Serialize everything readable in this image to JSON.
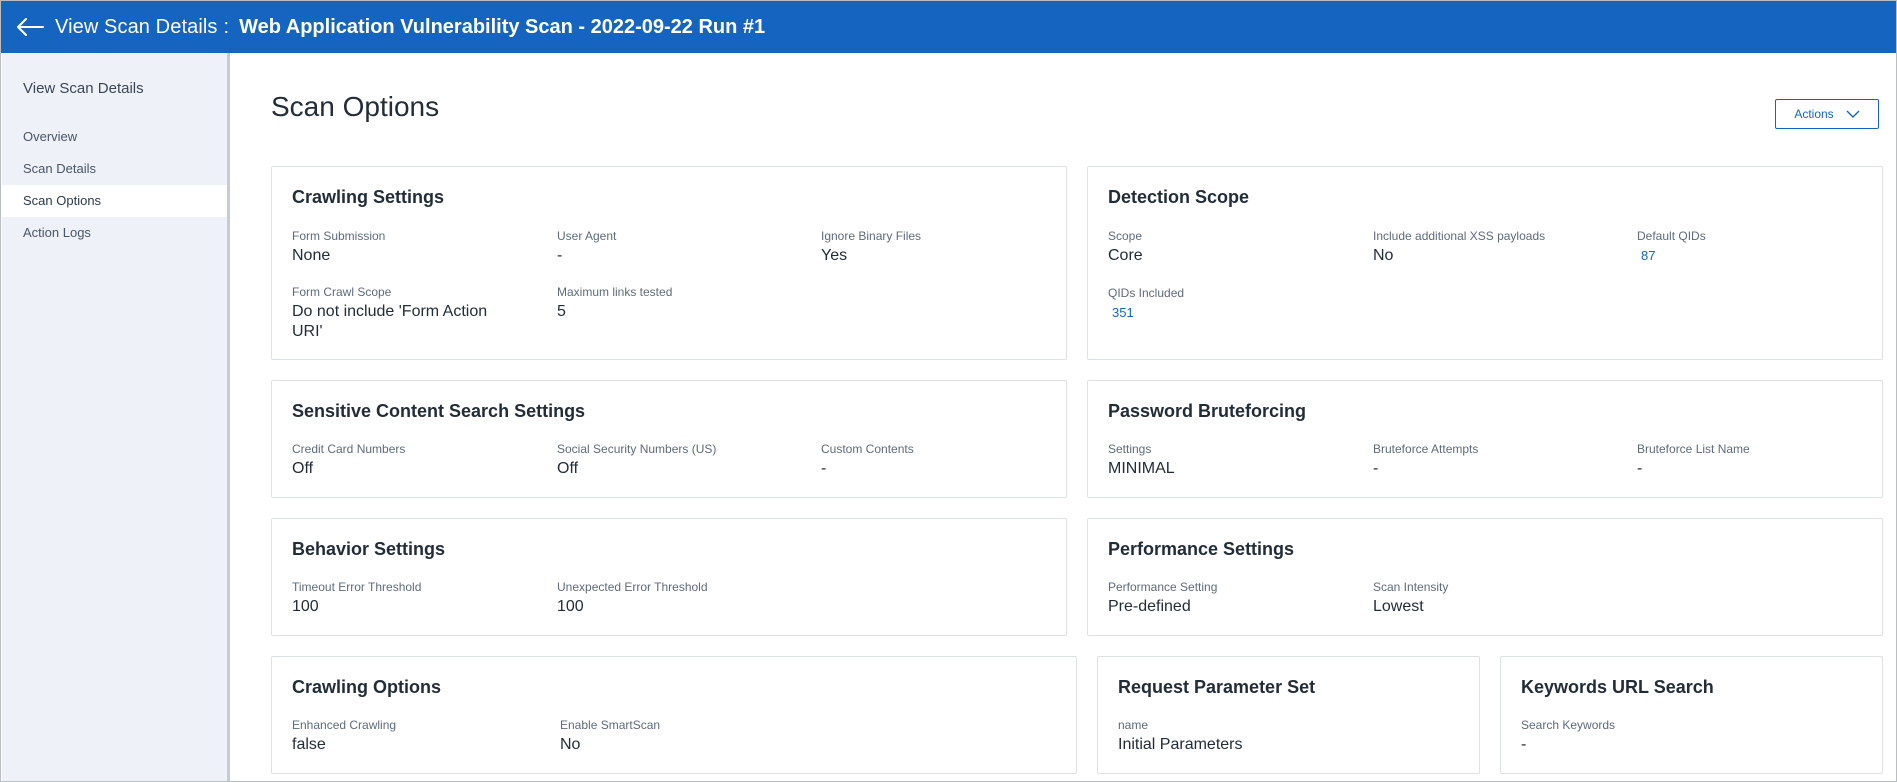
{
  "header": {
    "title_prefix": "View Scan Details",
    "separator": ":",
    "scan_name": "Web Application Vulnerability Scan - 2022-09-22 Run #1"
  },
  "sidebar": {
    "title": "View Scan Details",
    "items": [
      {
        "label": "Overview"
      },
      {
        "label": "Scan Details"
      },
      {
        "label": "Scan Options"
      },
      {
        "label": "Action Logs"
      }
    ]
  },
  "page": {
    "title": "Scan Options",
    "actions_label": "Actions"
  },
  "cards": {
    "crawling_settings": {
      "title": "Crawling Settings",
      "fields": [
        {
          "label": "Form Submission",
          "value": "None"
        },
        {
          "label": "User Agent",
          "value": "-"
        },
        {
          "label": "Ignore Binary Files",
          "value": "Yes"
        },
        {
          "label": "Form Crawl Scope",
          "value": "Do not include 'Form Action URI'"
        },
        {
          "label": "Maximum links tested",
          "value": "5"
        }
      ]
    },
    "detection_scope": {
      "title": "Detection Scope",
      "fields": [
        {
          "label": "Scope",
          "value": "Core"
        },
        {
          "label": "Include additional XSS payloads",
          "value": "No"
        },
        {
          "label": "Default QIDs",
          "value": "87"
        },
        {
          "label": "QIDs Included",
          "value": "351"
        }
      ]
    },
    "sensitive_content": {
      "title": "Sensitive Content Search Settings",
      "fields": [
        {
          "label": "Credit Card Numbers",
          "value": "Off"
        },
        {
          "label": "Social Security Numbers (US)",
          "value": "Off"
        },
        {
          "label": "Custom Contents",
          "value": "-"
        }
      ]
    },
    "password_bruteforcing": {
      "title": "Password Bruteforcing",
      "fields": [
        {
          "label": "Settings",
          "value": "MINIMAL"
        },
        {
          "label": "Bruteforce Attempts",
          "value": "-"
        },
        {
          "label": "Bruteforce List Name",
          "value": "-"
        }
      ]
    },
    "behavior_settings": {
      "title": "Behavior Settings",
      "fields": [
        {
          "label": "Timeout Error Threshold",
          "value": "100"
        },
        {
          "label": "Unexpected Error Threshold",
          "value": "100"
        }
      ]
    },
    "performance_settings": {
      "title": "Performance Settings",
      "fields": [
        {
          "label": "Performance Setting",
          "value": "Pre-defined"
        },
        {
          "label": "Scan Intensity",
          "value": "Lowest"
        }
      ]
    },
    "crawling_options": {
      "title": "Crawling Options",
      "fields": [
        {
          "label": "Enhanced Crawling",
          "value": "false"
        },
        {
          "label": "Enable SmartScan",
          "value": "No"
        }
      ]
    },
    "request_parameter_set": {
      "title": "Request Parameter Set",
      "fields": [
        {
          "label": "name",
          "value": "Initial Parameters"
        }
      ]
    },
    "keywords_url_search": {
      "title": "Keywords URL Search",
      "fields": [
        {
          "label": "Search Keywords",
          "value": "-"
        }
      ]
    }
  },
  "colors": {
    "header_bg": "#1565c0",
    "sidebar_bg": "#eef2f8",
    "link": "#1565c0"
  },
  "icons": {
    "back": "arrow-left-icon",
    "actions": "chevron-down-icon"
  }
}
